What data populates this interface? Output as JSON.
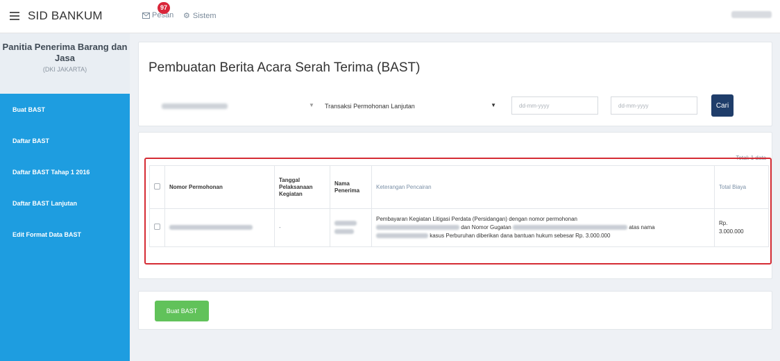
{
  "app": {
    "title": "SID BANKUM"
  },
  "topnav": {
    "pesan_label": "Pesan",
    "pesan_badge": "97",
    "sistem_label": "Sistem"
  },
  "sidebar": {
    "org_title": "Panitia Penerima Barang dan Jasa",
    "org_region": "(DKI JAKARTA)",
    "items": [
      {
        "label": "Buat BAST"
      },
      {
        "label": "Daftar BAST"
      },
      {
        "label": "Daftar BAST Tahap 1 2016"
      },
      {
        "label": "Daftar BAST Lanjutan"
      },
      {
        "label": "Edit Format Data BAST"
      }
    ]
  },
  "main": {
    "page_title": "Pembuatan Berita Acara Serah Terima (BAST)",
    "filters": {
      "transaction_type": "Transaksi Permohonan Lanjutan",
      "date_from_placeholder": "dd-mm-yyyy",
      "date_to_placeholder": "dd-mm-yyyy",
      "search_label": "Cari"
    },
    "total_label": "Total: 1 data",
    "table": {
      "headers": [
        "Nomor Permohonan",
        "Tanggal Pelaksanaan Kegiatan",
        "Nama Penerima",
        "Keterangan Pencairan",
        "Total Biaya"
      ],
      "rows": [
        {
          "tanggal": "-",
          "ket_part1": "Pembayaran Kegiatan Litigasi Perdata (Persidangan) dengan nomor permohonan",
          "ket_part2": "dan Nomor Gugatan",
          "ket_part3": "atas nama",
          "ket_part4": "kasus Perburuhan diberikan dana bantuan hukum sebesar Rp. 3.000.000",
          "total_currency": "Rp.",
          "total_amount": "3.000.000"
        }
      ]
    },
    "create_button": "Buat BAST"
  }
}
